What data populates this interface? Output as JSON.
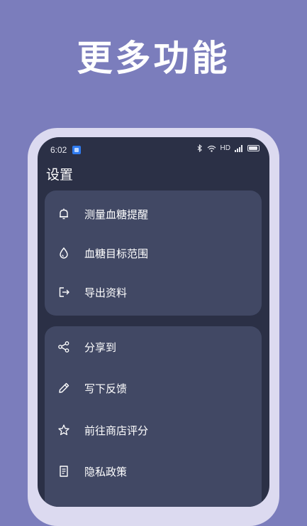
{
  "headline": "更多功能",
  "status_bar": {
    "time": "6:02",
    "network": "HD",
    "icons": [
      "app-badge-icon",
      "bluetooth-icon",
      "wifi-icon",
      "signal-icon",
      "battery-icon"
    ]
  },
  "page_title": "设置",
  "sections": [
    {
      "items": [
        {
          "label": "测量血糖提醒",
          "icon": "bell-icon"
        },
        {
          "label": "血糖目标范围",
          "icon": "drop-icon"
        },
        {
          "label": "导出资料",
          "icon": "export-icon"
        }
      ]
    },
    {
      "items": [
        {
          "label": "分享到",
          "icon": "share-icon"
        },
        {
          "label": "写下反馈",
          "icon": "pencil-icon"
        },
        {
          "label": "前往商店评分",
          "icon": "star-icon"
        },
        {
          "label": "隐私政策",
          "icon": "document-icon"
        }
      ]
    }
  ],
  "colors": {
    "background": "#7b7dbc",
    "frame": "#dcdaf0",
    "screen": "#2b3046",
    "card": "#414864",
    "text": "#ffffff"
  }
}
